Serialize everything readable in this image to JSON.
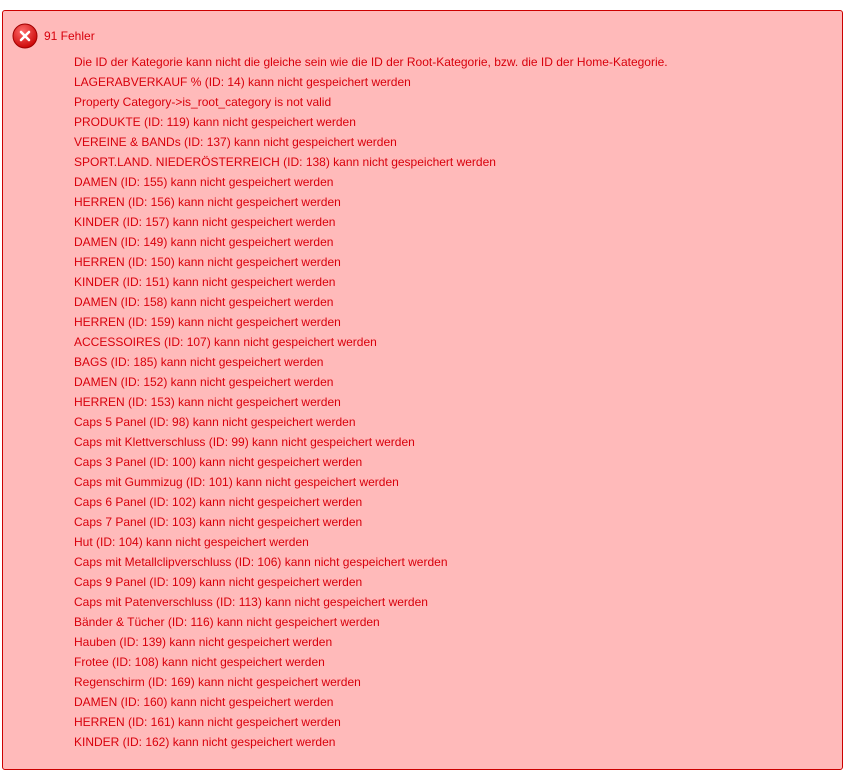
{
  "alert": {
    "icon": "error-circle-x-icon",
    "count_label": "91 Fehler",
    "colors": {
      "background": "#ffbaba",
      "text": "#d8000c",
      "border": "#cc0000",
      "icon": "#e02020"
    },
    "messages": [
      "Die ID der Kategorie kann nicht die gleiche sein wie die ID der Root-Kategorie, bzw. die ID der Home-Kategorie.",
      "LAGERABVERKAUF % (ID: 14) kann nicht gespeichert werden",
      "Property Category->is_root_category is not valid",
      "PRODUKTE (ID: 119) kann nicht gespeichert werden",
      "VEREINE & BANDs (ID: 137) kann nicht gespeichert werden",
      "SPORT.LAND. NIEDERÖSTERREICH (ID: 138) kann nicht gespeichert werden",
      "DAMEN (ID: 155) kann nicht gespeichert werden",
      "HERREN (ID: 156) kann nicht gespeichert werden",
      "KINDER (ID: 157) kann nicht gespeichert werden",
      "DAMEN (ID: 149) kann nicht gespeichert werden",
      "HERREN (ID: 150) kann nicht gespeichert werden",
      "KINDER (ID: 151) kann nicht gespeichert werden",
      "DAMEN (ID: 158) kann nicht gespeichert werden",
      "HERREN (ID: 159) kann nicht gespeichert werden",
      "ACCESSOIRES (ID: 107) kann nicht gespeichert werden",
      "BAGS (ID: 185) kann nicht gespeichert werden",
      "DAMEN (ID: 152) kann nicht gespeichert werden",
      "HERREN (ID: 153) kann nicht gespeichert werden",
      "Caps 5 Panel (ID: 98) kann nicht gespeichert werden",
      "Caps mit Klettverschluss (ID: 99) kann nicht gespeichert werden",
      "Caps 3 Panel (ID: 100) kann nicht gespeichert werden",
      "Caps mit Gummizug (ID: 101) kann nicht gespeichert werden",
      "Caps 6 Panel (ID: 102) kann nicht gespeichert werden",
      "Caps 7 Panel (ID: 103) kann nicht gespeichert werden",
      "Hut (ID: 104) kann nicht gespeichert werden",
      "Caps mit Metallclipverschluss (ID: 106) kann nicht gespeichert werden",
      "Caps 9 Panel (ID: 109) kann nicht gespeichert werden",
      "Caps mit Patenverschluss (ID: 113) kann nicht gespeichert werden",
      "Bänder & Tücher (ID: 116) kann nicht gespeichert werden",
      "Hauben (ID: 139) kann nicht gespeichert werden",
      "Frotee (ID: 108) kann nicht gespeichert werden",
      "Regenschirm (ID: 169) kann nicht gespeichert werden",
      "DAMEN (ID: 160) kann nicht gespeichert werden",
      "HERREN (ID: 161) kann nicht gespeichert werden",
      "KINDER (ID: 162) kann nicht gespeichert werden"
    ]
  }
}
